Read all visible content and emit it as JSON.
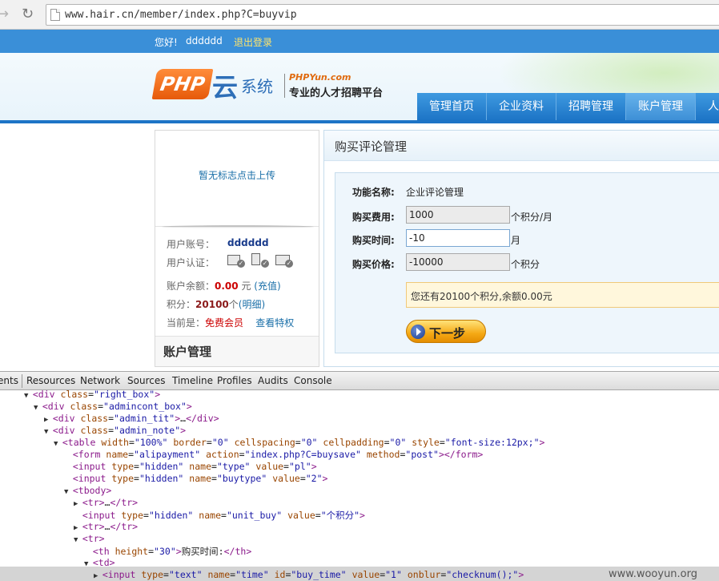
{
  "browser": {
    "url": "www.hair.cn/member/index.php?C=buyvip"
  },
  "topbar": {
    "greeting": "您好!",
    "username": "dddddd",
    "logout": "退出登录"
  },
  "logo": {
    "php": "PHP",
    "yun": "云",
    "xitong": "系统",
    "brand": "PHPYun.com",
    "slogan": "专业的人才招聘平台"
  },
  "nav": {
    "tabs": [
      {
        "label": "管理首页",
        "active": false
      },
      {
        "label": "企业资料",
        "active": false
      },
      {
        "label": "招聘管理",
        "active": false
      },
      {
        "label": "账户管理",
        "active": true
      },
      {
        "label": "人",
        "active": false
      }
    ]
  },
  "sidebar": {
    "upload_text": "暂无标志点击上传",
    "account_label": "用户账号：",
    "account_value": "dddddd",
    "cert_label": "用户认证：",
    "balance_label": "账户余额：",
    "balance_value": "0.00",
    "balance_unit": "元",
    "recharge": "(充值)",
    "points_label": "积分：",
    "points_value": "20100",
    "points_unit": "个",
    "points_detail": "(明细)",
    "current_label": "当前是：",
    "member_type": "免费会员",
    "view_privilege": "查看特权",
    "section_title": "账户管理"
  },
  "main": {
    "title": "购买评论管理",
    "fields": {
      "name_label": "功能名称:",
      "name_value": "企业评论管理",
      "fee_label": "购买费用:",
      "fee_value": "1000",
      "fee_unit": "个积分/月",
      "time_label": "购买时间:",
      "time_value": "-10",
      "time_unit": "月",
      "price_label": "购买价格:",
      "price_value": "-10000",
      "price_unit": "个积分"
    },
    "notice": "您还有20100个积分,余额0.00元",
    "next_button": "下一步"
  },
  "devtools": {
    "tabs": [
      "ents",
      "Resources",
      "Network",
      "Sources",
      "Timeline",
      "Profiles",
      "Audits",
      "Console"
    ],
    "lines": [
      {
        "indent": 42,
        "tri": "▼",
        "html": "<span class='tg'>&lt;div</span> <span class='an'>class</span>=<span class='av'>\"right_box\"</span><span class='tg'>&gt;</span>"
      },
      {
        "indent": 54,
        "tri": "▼",
        "html": "<span class='tg'>&lt;div</span> <span class='an'>class</span>=<span class='av'>\"admincont_box\"</span><span class='tg'>&gt;</span>"
      },
      {
        "indent": 67,
        "tri": "▶",
        "html": "<span class='tg'>&lt;div</span> <span class='an'>class</span>=<span class='av'>\"admin_tit\"</span><span class='tg'>&gt;</span>…<span class='tg'>&lt;/div&gt;</span>"
      },
      {
        "indent": 67,
        "tri": "▼",
        "html": "<span class='tg'>&lt;div</span> <span class='an'>class</span>=<span class='av'>\"admin_note\"</span><span class='tg'>&gt;</span>"
      },
      {
        "indent": 79,
        "tri": "▼",
        "html": "<span class='tg'>&lt;table</span> <span class='an'>width</span>=<span class='av'>\"100%\"</span> <span class='an'>border</span>=<span class='av'>\"0\"</span> <span class='an'>cellspacing</span>=<span class='av'>\"0\"</span> <span class='an'>cellpadding</span>=<span class='av'>\"0\"</span> <span class='an'>style</span>=<span class='av'>\"font-size:12px;\"</span><span class='tg'>&gt;</span>"
      },
      {
        "indent": 92,
        "tri": "",
        "html": "<span class='tg'>&lt;form</span> <span class='an'>name</span>=<span class='av'>\"alipayment\"</span> <span class='an'>action</span>=<span class='av'>\"index.php?C=buysave\"</span> <span class='an'>method</span>=<span class='av'>\"post\"</span><span class='tg'>&gt;&lt;/form&gt;</span>"
      },
      {
        "indent": 92,
        "tri": "",
        "html": "<span class='tg'>&lt;input</span> <span class='an'>type</span>=<span class='av'>\"hidden\"</span> <span class='an'>name</span>=<span class='av'>\"type\"</span> <span class='an'>value</span>=<span class='av'>\"pl\"</span><span class='tg'>&gt;</span>"
      },
      {
        "indent": 92,
        "tri": "",
        "html": "<span class='tg'>&lt;input</span> <span class='an'>type</span>=<span class='av'>\"hidden\"</span> <span class='an'>name</span>=<span class='av'>\"buytype\"</span> <span class='an'>value</span>=<span class='av'>\"2\"</span><span class='tg'>&gt;</span>"
      },
      {
        "indent": 92,
        "tri": "▼",
        "html": "<span class='tg'>&lt;tbody&gt;</span>"
      },
      {
        "indent": 104,
        "tri": "▶",
        "html": "<span class='tg'>&lt;tr&gt;</span>…<span class='tg'>&lt;/tr&gt;</span>"
      },
      {
        "indent": 104,
        "tri": "",
        "html": "<span class='tg'>&lt;input</span> <span class='an'>type</span>=<span class='av'>\"hidden\"</span> <span class='an'>name</span>=<span class='av'>\"unit_buy\"</span> <span class='an'>value</span>=<span class='av'>\"个积分\"</span><span class='tg'>&gt;</span>"
      },
      {
        "indent": 104,
        "tri": "▶",
        "html": "<span class='tg'>&lt;tr&gt;</span>…<span class='tg'>&lt;/tr&gt;</span>"
      },
      {
        "indent": 104,
        "tri": "▼",
        "html": "<span class='tg'>&lt;tr&gt;</span>"
      },
      {
        "indent": 117,
        "tri": "",
        "html": "<span class='tg'>&lt;th</span> <span class='an'>height</span>=<span class='av'>\"30\"</span><span class='tg'>&gt;</span><span class='tx'>购买时间:</span><span class='tg'>&lt;/th&gt;</span>"
      },
      {
        "indent": 117,
        "tri": "▼",
        "html": "<span class='tg'>&lt;td&gt;</span>"
      },
      {
        "indent": 129,
        "tri": "▶",
        "html": "<span class='tg'>&lt;input</span> <span class='an'>type</span>=<span class='av'>\"text\"</span> <span class='an'>name</span>=<span class='av'>\"time\"</span> <span class='an'>id</span>=<span class='av'>\"buy_time\"</span> <span class='an'>value</span>=<span class='av'>\"1\"</span> <span class='an'>onblur</span>=<span class='av'>\"checknum();\"</span><span class='tg'>&gt;</span>"
      }
    ],
    "watermark": "www.wooyun.org"
  }
}
